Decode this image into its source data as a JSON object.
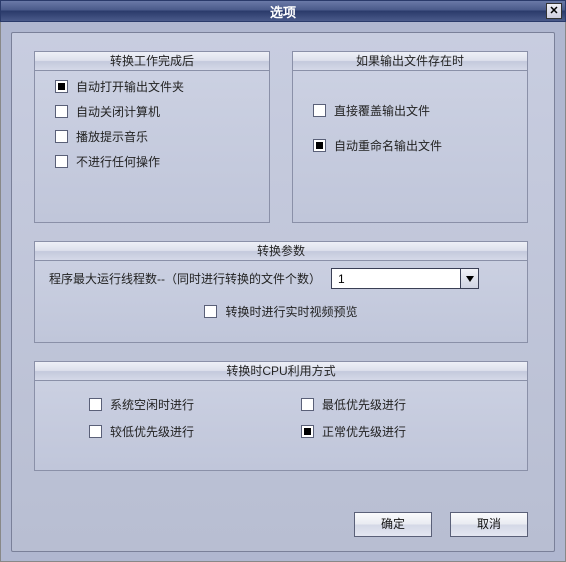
{
  "window": {
    "title": "选项"
  },
  "groups": {
    "afterConversion": {
      "legend": "转换工作完成后",
      "items": [
        {
          "label": "自动打开输出文件夹",
          "checked": true
        },
        {
          "label": "自动关闭计算机",
          "checked": false
        },
        {
          "label": "播放提示音乐",
          "checked": false
        },
        {
          "label": "不进行任何操作",
          "checked": false
        }
      ]
    },
    "outputExists": {
      "legend": "如果输出文件存在时",
      "items": [
        {
          "label": "直接覆盖输出文件",
          "checked": false
        },
        {
          "label": "自动重命名输出文件",
          "checked": true
        }
      ]
    },
    "params": {
      "legend": "转换参数",
      "threadsLabel": "程序最大运行线程数--（同时进行转换的文件个数）",
      "threadsValue": "1",
      "preview": {
        "label": "转换时进行实时视频预览",
        "checked": false
      }
    },
    "cpu": {
      "legend": "转换时CPU利用方式",
      "items": [
        {
          "label": "系统空闲时进行",
          "checked": false
        },
        {
          "label": "最低优先级进行",
          "checked": false
        },
        {
          "label": "较低优先级进行",
          "checked": false
        },
        {
          "label": "正常优先级进行",
          "checked": true
        }
      ]
    }
  },
  "buttons": {
    "ok": "确定",
    "cancel": "取消"
  }
}
